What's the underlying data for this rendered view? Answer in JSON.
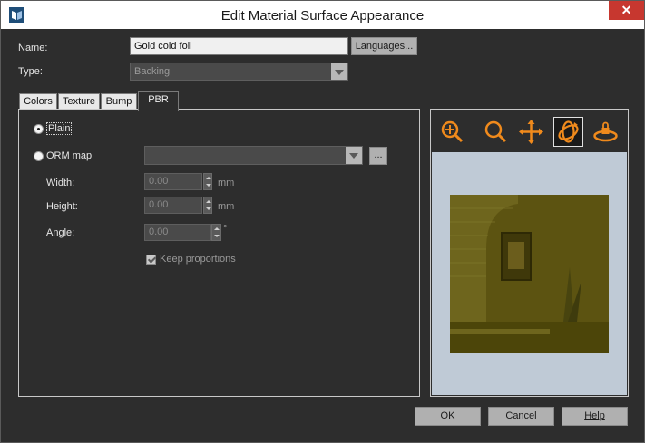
{
  "window": {
    "title": "Edit Material Surface Appearance",
    "close_glyph": "✕"
  },
  "form": {
    "name_label": "Name:",
    "name_value": "Gold cold foil",
    "languages_button": "Languages...",
    "type_label": "Type:",
    "type_value": "Backing"
  },
  "tabs": [
    {
      "label": "Colors",
      "active": false
    },
    {
      "label": "Texture",
      "active": false
    },
    {
      "label": "Bump",
      "active": false
    },
    {
      "label": "PBR",
      "active": true
    }
  ],
  "pbr": {
    "plain_label": "Plain",
    "plain_selected": true,
    "orm_label": "ORM map",
    "orm_value": "",
    "browse_button": "...",
    "width_label": "Width:",
    "width_value": "0.00",
    "width_unit": "mm",
    "height_label": "Height:",
    "height_value": "0.00",
    "height_unit": "mm",
    "angle_label": "Angle:",
    "angle_value": "0.00",
    "angle_unit": "°",
    "keep_proportions_label": "Keep proportions",
    "keep_proportions_checked": true
  },
  "preview_toolbar": [
    {
      "icon": "zoom-in-icon",
      "active": false
    },
    {
      "icon": "zoom-icon",
      "active": false
    },
    {
      "icon": "move-icon",
      "active": false
    },
    {
      "icon": "rotate-icon",
      "active": true
    },
    {
      "icon": "lock-rotate-icon",
      "active": false
    }
  ],
  "footer": {
    "ok": "OK",
    "cancel": "Cancel",
    "help": "Help"
  },
  "colors": {
    "accent_orange": "#f08a1c",
    "preview_bg": "#bfcad6",
    "preview_tint": "#5c5311"
  }
}
